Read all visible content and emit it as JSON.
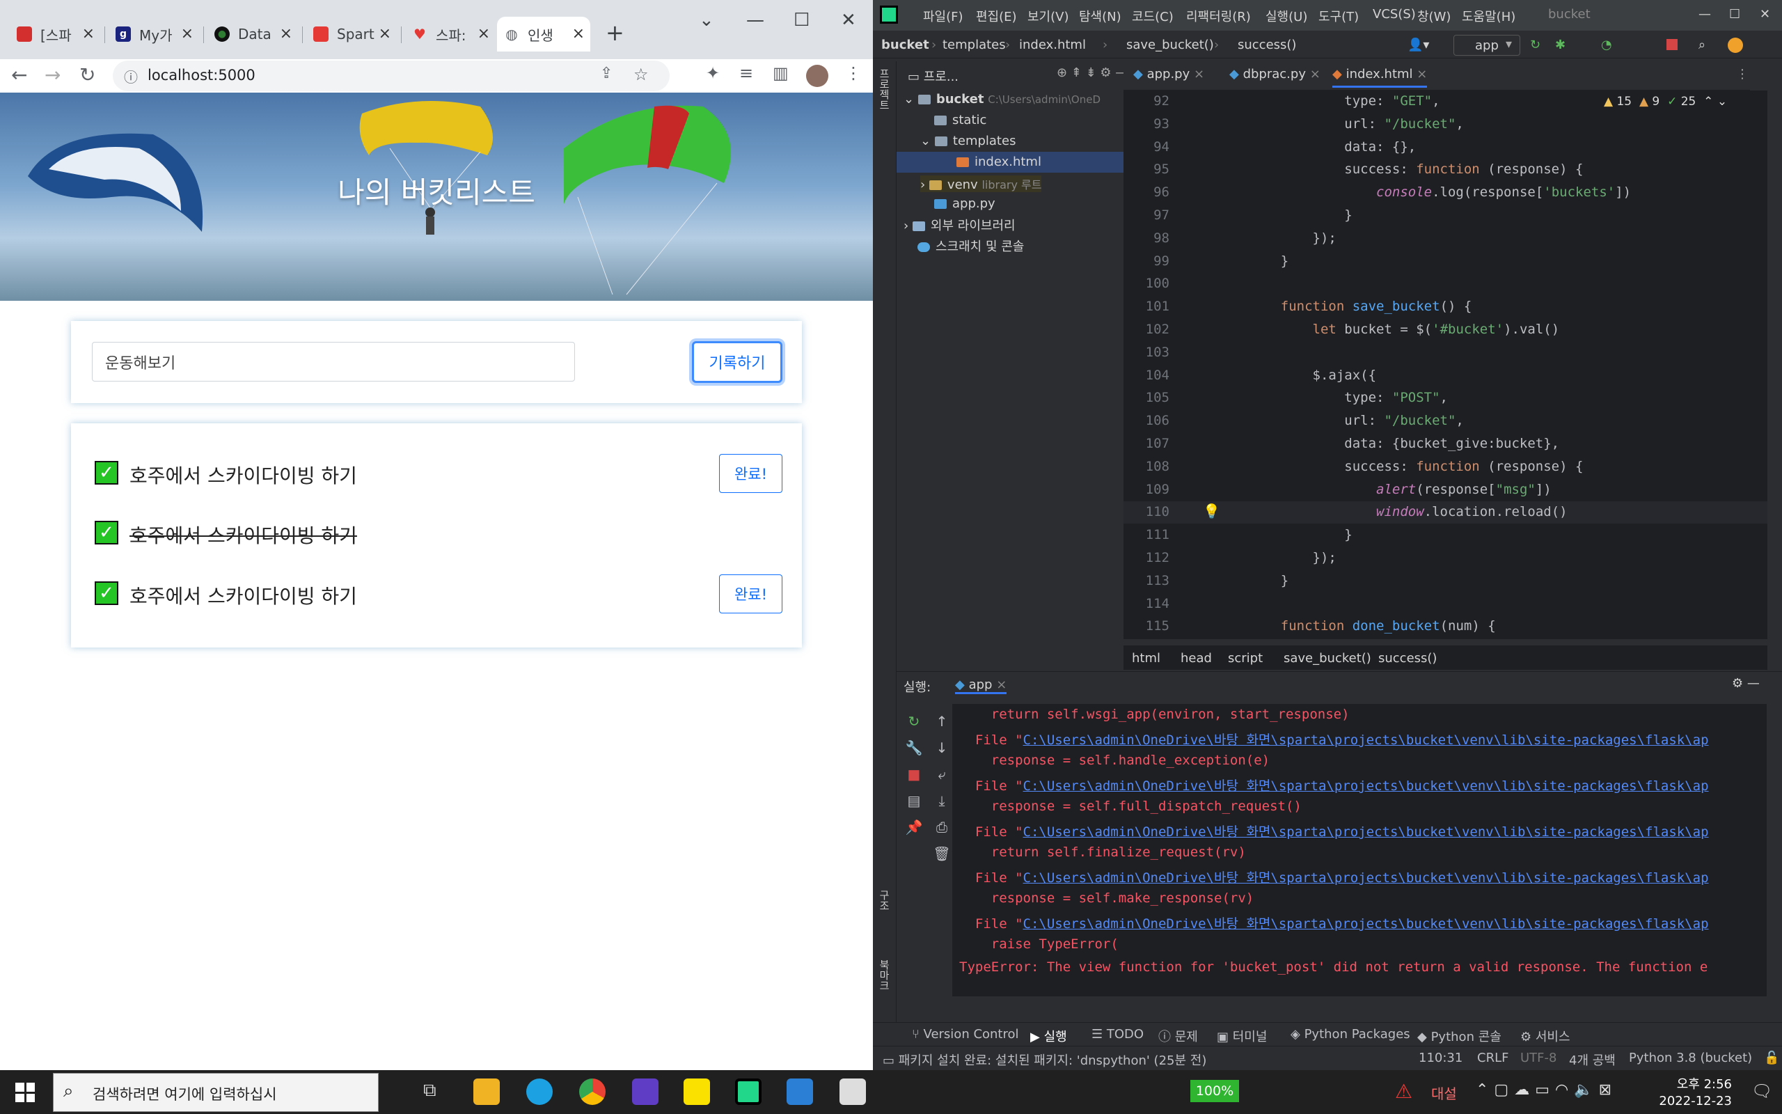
{
  "browser": {
    "tabs": [
      {
        "label": "[스파",
        "color": "#d32f2f"
      },
      {
        "label": "My가",
        "color": "#1a237e"
      },
      {
        "label": "Data",
        "color": "#2e7d32"
      },
      {
        "label": "Spart",
        "color": "#e53935"
      },
      {
        "label": "스파:",
        "color": "#e53935"
      },
      {
        "label": "인생",
        "color": "#5f6368"
      }
    ],
    "url": "localhost:5000",
    "page": {
      "title": "나의 버킷리스트",
      "input_value": "운동해보기",
      "record_button": "기록하기",
      "items": [
        {
          "text": "호주에서 스카이다이빙 하기",
          "done": false,
          "button": "완료!"
        },
        {
          "text": "호주에서 스카이다이빙 하기",
          "done": true,
          "button": ""
        },
        {
          "text": "호주에서 스카이다이빙 하기",
          "done": false,
          "button": "완료!"
        }
      ]
    }
  },
  "ide": {
    "menu": [
      "파일(F)",
      "편집(E)",
      "보기(V)",
      "탐색(N)",
      "코드(C)",
      "리팩터링(R)",
      "실행(U)",
      "도구(T)",
      "VCS(S)",
      "창(W)",
      "도움말(H)"
    ],
    "project_name_label": "bucket",
    "breadcrumbs": [
      "bucket",
      "templates",
      "index.html",
      "save_bucket()",
      "success()"
    ],
    "run_config": "app",
    "project_panel_title": "프로...",
    "tree": [
      {
        "label": "bucket",
        "extra": "C:\\Users\\admin\\OneD",
        "indent": 0
      },
      {
        "label": "static",
        "extra": "",
        "indent": 1
      },
      {
        "label": "templates",
        "extra": "",
        "indent": 1
      },
      {
        "label": "index.html",
        "extra": "",
        "indent": 2
      },
      {
        "label": "venv",
        "extra": "library 루트",
        "indent": 1
      },
      {
        "label": "app.py",
        "extra": "",
        "indent": 1
      },
      {
        "label": "외부 라이브러리",
        "extra": "",
        "indent": 0
      },
      {
        "label": "스크래치 및 콘솔",
        "extra": "",
        "indent": 0
      }
    ],
    "editor_tabs": [
      "app.py",
      "dbprac.py",
      "index.html"
    ],
    "inspections": {
      "warn_a": "15",
      "warn_b": "9",
      "ok": "25"
    },
    "code_lines": [
      {
        "n": "92",
        "t": "            type: \"GET\","
      },
      {
        "n": "93",
        "t": "            url: \"/bucket\","
      },
      {
        "n": "94",
        "t": "            data: {},"
      },
      {
        "n": "95",
        "t": "            success: function (response) {"
      },
      {
        "n": "96",
        "t": "                console.log(response['buckets'])"
      },
      {
        "n": "97",
        "t": "            }"
      },
      {
        "n": "98",
        "t": "        });"
      },
      {
        "n": "99",
        "t": "    }"
      },
      {
        "n": "100",
        "t": ""
      },
      {
        "n": "101",
        "t": "    function save_bucket() {"
      },
      {
        "n": "102",
        "t": "        let bucket = $('#bucket').val()"
      },
      {
        "n": "103",
        "t": ""
      },
      {
        "n": "104",
        "t": "        $.ajax({"
      },
      {
        "n": "105",
        "t": "            type: \"POST\","
      },
      {
        "n": "106",
        "t": "            url: \"/bucket\","
      },
      {
        "n": "107",
        "t": "            data: {bucket_give:bucket},"
      },
      {
        "n": "108",
        "t": "            success: function (response) {"
      },
      {
        "n": "109",
        "t": "                alert(response[\"msg\"])"
      },
      {
        "n": "110",
        "t": "                window.location.reload()"
      },
      {
        "n": "111",
        "t": "            }"
      },
      {
        "n": "112",
        "t": "        });"
      },
      {
        "n": "113",
        "t": "    }"
      },
      {
        "n": "114",
        "t": ""
      },
      {
        "n": "115",
        "t": "    function done_bucket(num) {"
      }
    ],
    "editor_crumbs": [
      "html",
      "head",
      "script",
      "save_bucket()",
      "success()"
    ],
    "run_label": "실행:",
    "run_tab": "app",
    "console_lines": [
      {
        "pre": "    return self.wsgi_app(environ, start_response)",
        "link": ""
      },
      {
        "pre": "  File \"",
        "link": "C:\\Users\\admin\\OneDrive\\바탕 화면\\sparta\\projects\\bucket\\venv\\lib\\site-packages\\flask\\ap"
      },
      {
        "pre": "    response = self.handle_exception(e)",
        "link": ""
      },
      {
        "pre": "  File \"",
        "link": "C:\\Users\\admin\\OneDrive\\바탕 화면\\sparta\\projects\\bucket\\venv\\lib\\site-packages\\flask\\ap"
      },
      {
        "pre": "    response = self.full_dispatch_request()",
        "link": ""
      },
      {
        "pre": "  File \"",
        "link": "C:\\Users\\admin\\OneDrive\\바탕 화면\\sparta\\projects\\bucket\\venv\\lib\\site-packages\\flask\\ap"
      },
      {
        "pre": "    return self.finalize_request(rv)",
        "link": ""
      },
      {
        "pre": "  File \"",
        "link": "C:\\Users\\admin\\OneDrive\\바탕 화면\\sparta\\projects\\bucket\\venv\\lib\\site-packages\\flask\\ap"
      },
      {
        "pre": "    response = self.make_response(rv)",
        "link": ""
      },
      {
        "pre": "  File \"",
        "link": "C:\\Users\\admin\\OneDrive\\바탕 화면\\sparta\\projects\\bucket\\venv\\lib\\site-packages\\flask\\ap"
      },
      {
        "pre": "    raise TypeError(",
        "link": ""
      },
      {
        "pre": "TypeError: The view function for 'bucket_post' did not return a valid response. The function e",
        "link": ""
      }
    ],
    "bottom_tabs": [
      "Version Control",
      "실행",
      "TODO",
      "문제",
      "터미널",
      "Python Packages",
      "Python 콘솔",
      "서비스"
    ],
    "status": {
      "message": "패키지 설치 완료: 설치된 패키지: 'dnspython' (25분 전)",
      "position": "110:31",
      "line_sep": "CRLF",
      "encoding": "UTF-8",
      "indent": "4개 공백",
      "interpreter": "Python 3.8 (bucket)"
    }
  },
  "taskbar": {
    "search_placeholder": "검색하려면 여기에 입력하십시",
    "battery": "100%",
    "weather": "대설",
    "time": "오후 2:56",
    "date": "2022-12-23"
  }
}
